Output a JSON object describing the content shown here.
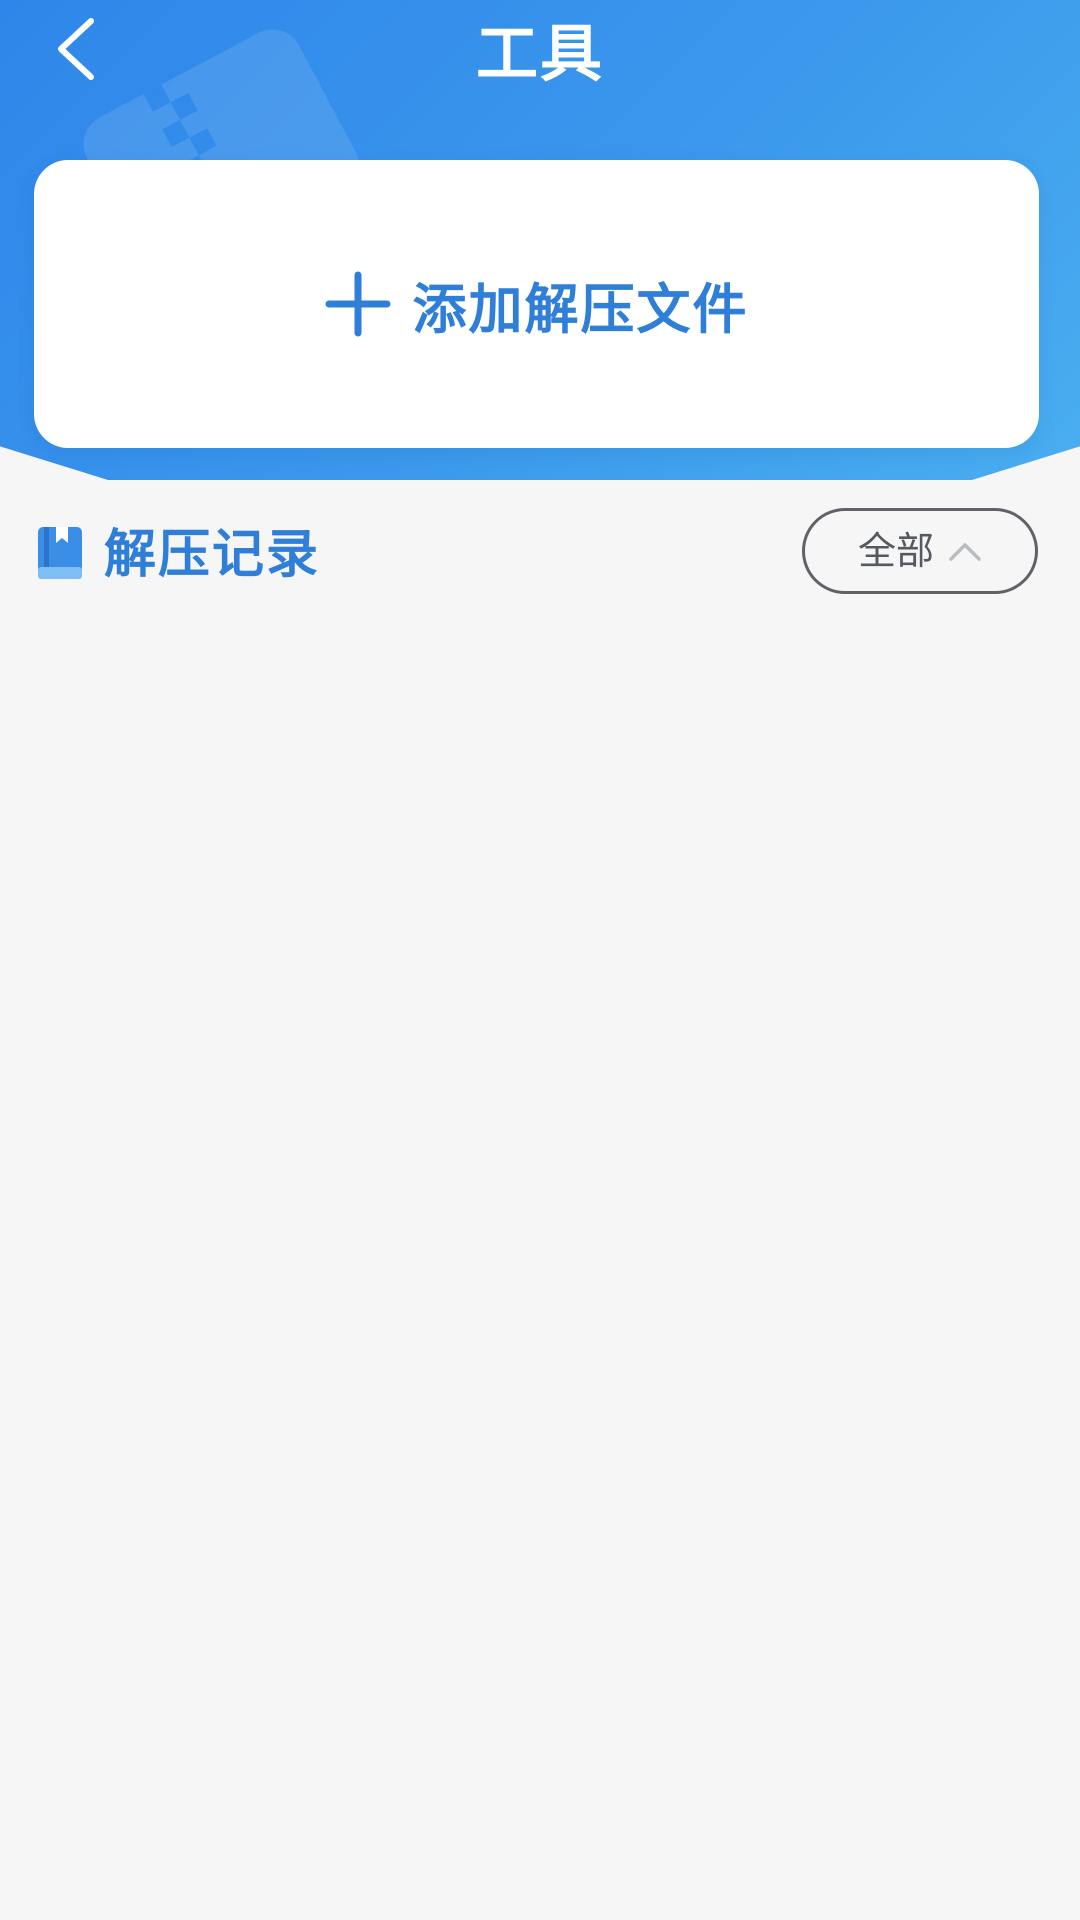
{
  "header": {
    "title": "工具"
  },
  "add_card": {
    "label": "添加解压文件"
  },
  "records": {
    "title": "解压记录",
    "filter": {
      "selected": "全部"
    },
    "items": []
  },
  "colors": {
    "accent": "#2f7fd9",
    "header_start": "#2f86ea",
    "header_end": "#4aaef0",
    "page_bg": "#f6f6f7"
  },
  "icons": {
    "back": "chevron-left-icon",
    "add": "plus-icon",
    "records": "book-icon",
    "filter": "chevron-up-icon"
  }
}
